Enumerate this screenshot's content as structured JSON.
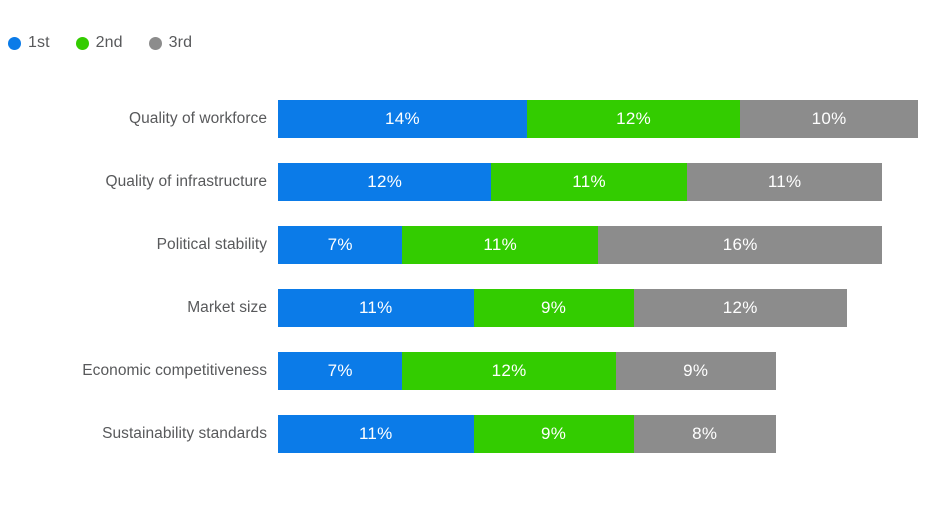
{
  "legend": {
    "position": "top-left",
    "items": [
      {
        "label": "1st",
        "color": "#0B7BE8",
        "icon": "circle-dot-icon"
      },
      {
        "label": "2nd",
        "color": "#33CC00",
        "icon": "circle-dot-icon"
      },
      {
        "label": "3rd",
        "color": "#8C8C8C",
        "icon": "circle-dot-icon"
      }
    ]
  },
  "colors": {
    "first": "#0B7BE8",
    "second": "#33CC00",
    "third": "#8C8C8C",
    "label_text": "#58595b",
    "value_text": "#ffffff",
    "background": "#ffffff"
  },
  "chart_data": {
    "type": "bar",
    "orientation": "horizontal",
    "stacked": true,
    "title": "",
    "subtitle": "",
    "xlabel": "",
    "ylabel": "",
    "grid": false,
    "legend_position": "top-left",
    "xlim": [
      0,
      36
    ],
    "value_suffix": "%",
    "categories": [
      "Quality of workforce",
      "Quality of infrastructure",
      "Political stability",
      "Market size",
      "Economic competitiveness",
      "Sustainability standards"
    ],
    "series": [
      {
        "name": "1st",
        "color": "#0B7BE8",
        "values": [
          14,
          12,
          7,
          11,
          7,
          11
        ]
      },
      {
        "name": "2nd",
        "color": "#33CC00",
        "values": [
          12,
          11,
          11,
          9,
          12,
          9
        ]
      },
      {
        "name": "3rd",
        "color": "#8C8C8C",
        "values": [
          10,
          11,
          16,
          12,
          9,
          8
        ]
      }
    ],
    "totals": [
      36,
      34,
      34,
      32,
      28,
      28
    ],
    "data_labels": [
      [
        "14%",
        "12%",
        "10%"
      ],
      [
        "12%",
        "11%",
        "11%"
      ],
      [
        "7%",
        "11%",
        "16%"
      ],
      [
        "11%",
        "9%",
        "12%"
      ],
      [
        "7%",
        "12%",
        "9%"
      ],
      [
        "11%",
        "9%",
        "8%"
      ]
    ]
  }
}
